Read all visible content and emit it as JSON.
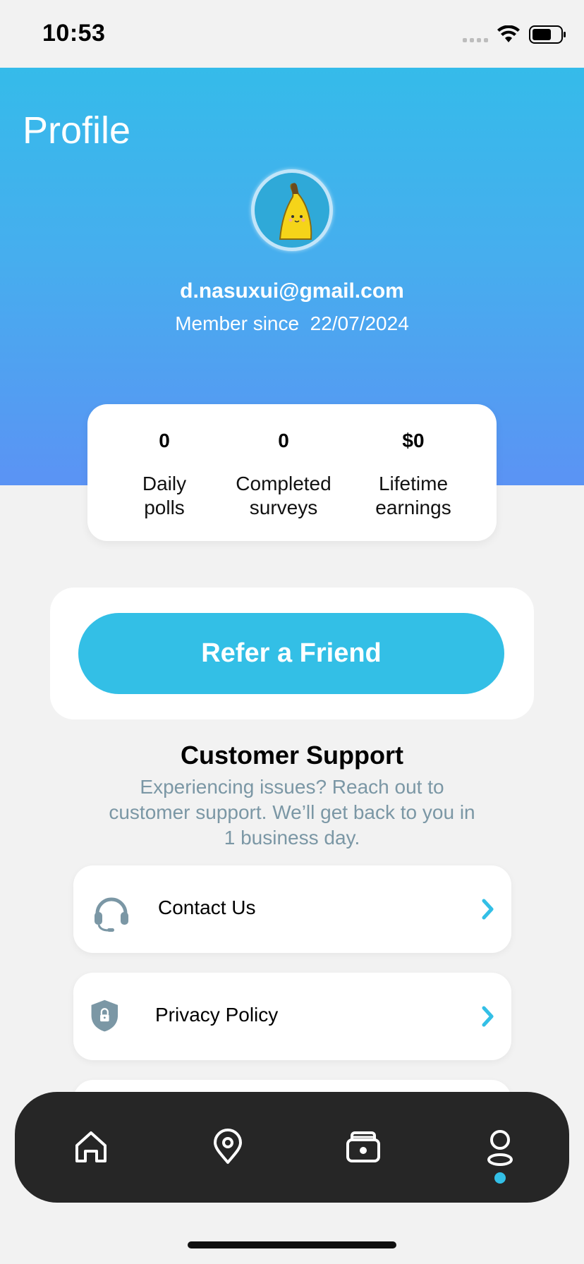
{
  "status_bar": {
    "time": "10:53"
  },
  "header": {
    "title": "Profile",
    "email": "d.nasuxui@gmail.com",
    "member_since": "Member since  22/07/2024"
  },
  "stats": [
    {
      "value": "0",
      "label_line1": "Daily",
      "label_line2": "polls"
    },
    {
      "value": "0",
      "label_line1": "Completed",
      "label_line2": "surveys"
    },
    {
      "value": "$0",
      "label_line1": "Lifetime",
      "label_line2": "earnings"
    }
  ],
  "refer": {
    "button_label": "Refer a Friend"
  },
  "support": {
    "title": "Customer Support",
    "description": "Experiencing issues? Reach out to customer support. We’ll get back to you in 1 business day.",
    "items": [
      {
        "label": "Contact Us",
        "icon": "headset-icon"
      },
      {
        "label": "Privacy Policy",
        "icon": "shield-lock-icon"
      }
    ]
  },
  "bottom_nav": {
    "items": [
      {
        "icon": "home-icon",
        "active": false
      },
      {
        "icon": "location-pin-icon",
        "active": false
      },
      {
        "icon": "wallet-icon",
        "active": false
      },
      {
        "icon": "profile-icon",
        "active": true
      }
    ]
  },
  "colors": {
    "accent": "#33bfe6",
    "header_gradient_top": "#35bbea",
    "header_gradient_bottom": "#5b93f4",
    "nav_background": "#262626",
    "muted_text": "#7b97a5"
  }
}
